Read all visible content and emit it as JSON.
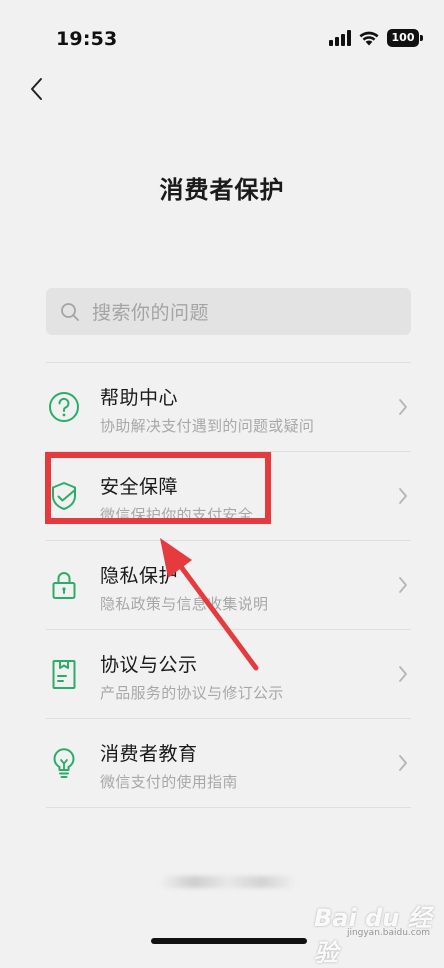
{
  "status_bar": {
    "time": "19:53",
    "battery": "100",
    "icons": [
      "signal-icon",
      "wifi-icon",
      "battery-icon"
    ]
  },
  "header": {
    "back_icon": "chevron-left-icon",
    "title": "消费者保护"
  },
  "search": {
    "placeholder": "搜索你的问题",
    "icon": "search-icon"
  },
  "menu": {
    "items": [
      {
        "icon": "question-circle-icon",
        "title": "帮助中心",
        "subtitle": "协助解决支付遇到的问题或疑问"
      },
      {
        "icon": "shield-check-icon",
        "title": "安全保障",
        "subtitle": "微信保护你的支付安全"
      },
      {
        "icon": "lock-icon",
        "title": "隐私保护",
        "subtitle": "隐私政策与信息收集说明"
      },
      {
        "icon": "agreement-document-icon",
        "title": "协议与公示",
        "subtitle": "产品服务的协议与修订公示"
      },
      {
        "icon": "lightbulb-icon",
        "title": "消费者教育",
        "subtitle": "微信支付的使用指南"
      }
    ]
  },
  "colors": {
    "accent_green": "#2aae67",
    "annotation_red": "#e53b3e",
    "background": "#f1f1f1"
  },
  "watermark": {
    "text": "Bai du 经验",
    "sub": "jingyan.baidu.com"
  }
}
